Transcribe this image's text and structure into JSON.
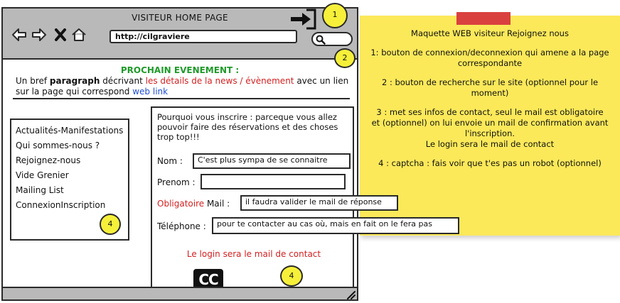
{
  "window": {
    "title": "VISITEUR HOME PAGE",
    "url": "http://cilgraviere"
  },
  "markers": [
    "1",
    "2",
    "4",
    "4"
  ],
  "event": {
    "heading": "PROCHAIN EVENEMENT :",
    "text_1": "Un bref ",
    "text_bold": "paragraph",
    "text_2": " décrivant ",
    "text_red": "les détails de la news / évènement",
    "text_3": " avec un lien sur la page qui correspond ",
    "link": "web link"
  },
  "sidebar": {
    "items": [
      {
        "label": "Actualités-Manifestations"
      },
      {
        "label": "Qui sommes-nous ?"
      },
      {
        "label": "Rejoignez-nous"
      },
      {
        "label": "Vide Grenier"
      },
      {
        "label": "Mailing List"
      },
      {
        "label": "ConnexionInscription"
      }
    ]
  },
  "form": {
    "intro": "Pourquoi vous inscrire : parceque vous allez pouvoir faire des réservations et des choses trop top!!!",
    "nom_label": "Nom :",
    "nom_value": "C'est plus sympa de se connaitre",
    "prenom_label": "Prenom :",
    "prenom_value": "",
    "obligatoire": "Obligatoire",
    "mail_label": " Mail :",
    "mail_value": "il faudra valider le mail de réponse",
    "tel_label": "Téléphone :",
    "tel_value": "pour te contacter au cas où, mais en fait on le fera pas",
    "login_note": "Le login sera le mail de contact",
    "captcha_text": "CC"
  },
  "note": {
    "lines": [
      "Maquette WEB visiteur Rejoignez nous",
      "1: bouton de connexion/deconnexion qui amene a la page\ncorrespondante",
      "2 : bouton de recherche sur le site (optionnel pour le\nmoment)",
      "3 : met ses infos de contact, seul le mail est obligatoire\net (optionnel) on lui envoie un mail de confirmation avant\nl'inscription.\nLe login sera le mail de contact",
      "4 : captcha : fais voir que t'es pas un robot (optionnel)"
    ]
  },
  "colors": {
    "green_heading": "#1f9a2a",
    "red_text": "#d42121",
    "link_blue": "#1f4fd1",
    "sticky_yellow": "#fbe95a",
    "marker_yellow": "#f6f03a",
    "chrome_gray": "#b9b9b9"
  },
  "icons": [
    "back-arrow-icon",
    "forward-arrow-icon",
    "close-x-icon",
    "home-icon",
    "search-icon",
    "login-icon",
    "resize-grip-icon",
    "captcha-icon"
  ]
}
